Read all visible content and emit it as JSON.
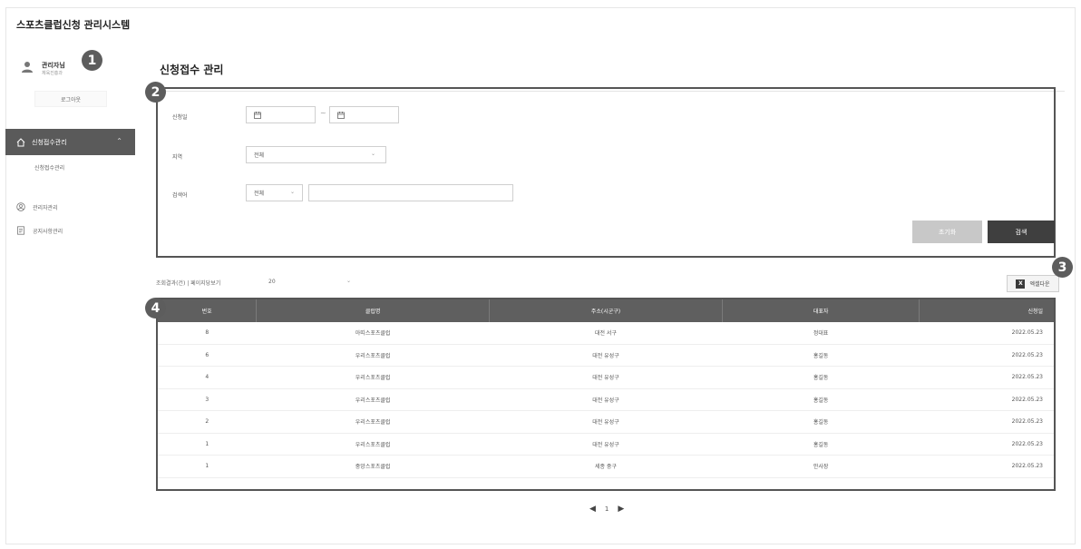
{
  "app": {
    "title": "스포츠클럽신청 관리시스템"
  },
  "user": {
    "name": "관리자님",
    "role": "체육진흥과",
    "logout_label": "로그아웃"
  },
  "badges": [
    "1",
    "2",
    "3",
    "4"
  ],
  "sidebar": {
    "active": {
      "label": "신청접수관리",
      "icon": "home-icon"
    },
    "sub_item": "신청접수관리",
    "items": [
      {
        "label": "관리자관리",
        "icon": "user-circle-icon"
      },
      {
        "label": "공지사항관리",
        "icon": "document-icon"
      }
    ]
  },
  "page": {
    "title": "신청접수 관리"
  },
  "filters": {
    "date": {
      "label": "신청일",
      "separator": "~"
    },
    "region": {
      "label": "지역",
      "value": "전체"
    },
    "keyword": {
      "label": "검색어",
      "type_value": "전체",
      "value": ""
    },
    "reset_label": "초기화",
    "search_label": "검색"
  },
  "list": {
    "count_label": "조회결과(건) | 페이지당보기",
    "page_size": "20",
    "excel_label": "엑셀다운"
  },
  "table": {
    "columns": [
      "번호",
      "클럽명",
      "주소(시군구)",
      "대표자",
      "신청일"
    ],
    "rows": [
      [
        "8",
        "아띠스포츠클럽",
        "대전 서구",
        "정대표",
        "2022.05.23"
      ],
      [
        "6",
        "우리스포츠클럽",
        "대전 유성구",
        "홍길동",
        "2022.05.23"
      ],
      [
        "4",
        "우리스포츠클럽",
        "대전 유성구",
        "홍길동",
        "2022.05.23"
      ],
      [
        "3",
        "우리스포츠클럽",
        "대전 유성구",
        "홍길동",
        "2022.05.23"
      ],
      [
        "2",
        "우리스포츠클럽",
        "대전 유성구",
        "홍길동",
        "2022.05.23"
      ],
      [
        "1",
        "우리스포츠클럽",
        "대전 유성구",
        "홍길동",
        "2022.05.23"
      ],
      [
        "1",
        "중앙스포츠클럽",
        "세종 중구",
        "안사장",
        "2022.05.23"
      ]
    ]
  },
  "pagination": {
    "prev": "◀",
    "current": "1",
    "next": "▶"
  }
}
